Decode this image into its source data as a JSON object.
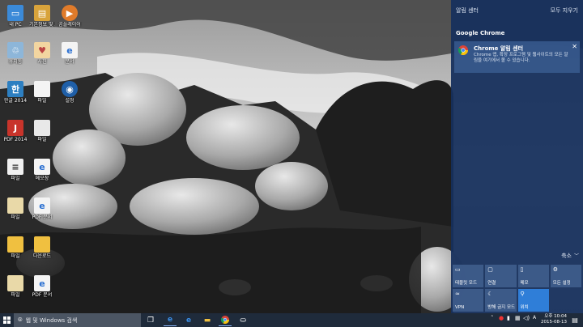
{
  "desktop": {
    "icons": [
      {
        "label": "내 PC"
      },
      {
        "label": "기본정보 및 프로그램"
      },
      {
        "label": "곰플레이어"
      },
      {
        "label": "휴지통"
      },
      {
        "label": "사진"
      },
      {
        "label": "문서"
      },
      {
        "label": "한글 2014"
      },
      {
        "label": "파일"
      },
      {
        "label": "설정"
      },
      {
        "label": "PDF 2014"
      },
      {
        "label": "파일"
      },
      {
        "label": "파일"
      },
      {
        "label": "메모장"
      },
      {
        "label": "파일"
      },
      {
        "label": "PDF 문서"
      },
      {
        "label": "파일"
      },
      {
        "label": "다운로드"
      },
      {
        "label": "파일"
      },
      {
        "label": "PDF 문서"
      }
    ]
  },
  "action_center": {
    "title": "알림 센터",
    "clear_all": "모두 지우기",
    "app_name": "Google Chrome",
    "notification": {
      "title": "Chrome 알림 센터",
      "body": "Chrome 앱, 확장 프로그램 및 웹사이트의 모든 알림을 여기에서 볼 수 있습니다.",
      "close": "✕"
    },
    "collapse": "축소",
    "quick_actions": [
      {
        "label": "태블릿 모드",
        "icon": "▭",
        "on": false
      },
      {
        "label": "연결",
        "icon": "▢",
        "on": false
      },
      {
        "label": "메모",
        "icon": "▯",
        "on": false
      },
      {
        "label": "모든 설정",
        "icon": "⚙",
        "on": false
      },
      {
        "label": "VPN",
        "icon": "≈",
        "on": false
      },
      {
        "label": "방해 금지 모드",
        "icon": "☾",
        "on": false
      },
      {
        "label": "위치",
        "icon": "⚲",
        "on": true
      }
    ]
  },
  "taskbar": {
    "search_placeholder": "웹 및 Windows 검색",
    "time": "오후 10:04",
    "date": "2015-08-13"
  }
}
